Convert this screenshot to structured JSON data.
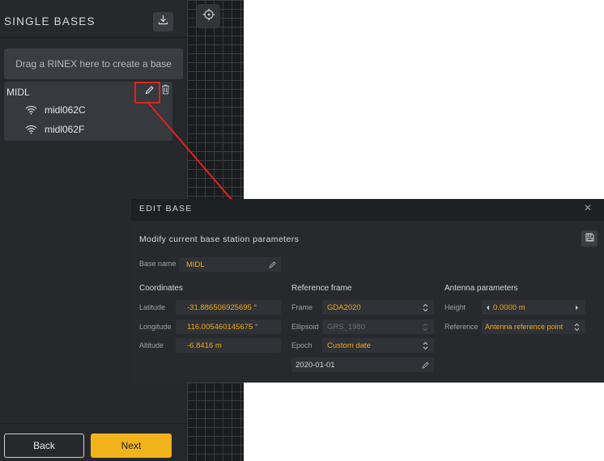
{
  "sidebar": {
    "title": "SINGLE BASES",
    "dropzone_text": "Drag a RINEX here to create a base",
    "base": {
      "name": "MIDL",
      "rovers": [
        "midl062C",
        "midl062F"
      ]
    },
    "back_label": "Back",
    "next_label": "Next"
  },
  "dialog": {
    "title": "EDIT BASE",
    "subtitle": "Modify current base station parameters",
    "base_name_label": "Base name",
    "base_name_value": "MIDL",
    "coordinates": {
      "header": "Coordinates",
      "latitude_label": "Latitude",
      "latitude_value": "-31.886506925695 °",
      "longitude_label": "Longitude",
      "longitude_value": "116.005460145675 °",
      "altitude_label": "Altitude",
      "altitude_value": "-6.8416 m"
    },
    "reference_frame": {
      "header": "Reference frame",
      "frame_label": "Frame",
      "frame_value": "GDA2020",
      "ellipsoid_label": "Ellipsoid",
      "ellipsoid_value": "GRS_1980",
      "epoch_label": "Epoch",
      "epoch_value": "Custom date",
      "date_value": "2020-01-01"
    },
    "antenna": {
      "header": "Antenna parameters",
      "height_label": "Height",
      "height_value": "0.0000 m",
      "reference_label": "Reference",
      "reference_value": "Antenna reference point"
    }
  },
  "colors": {
    "accent": "#f1b31b",
    "field_value": "#f0a91a",
    "highlight": "#e0241b"
  },
  "icons": [
    "download-icon",
    "pencil-icon",
    "trash-icon",
    "wifi-icon",
    "crosshair-icon",
    "close-icon",
    "save-icon",
    "updown-icon",
    "caret-left-icon",
    "caret-right-icon"
  ]
}
